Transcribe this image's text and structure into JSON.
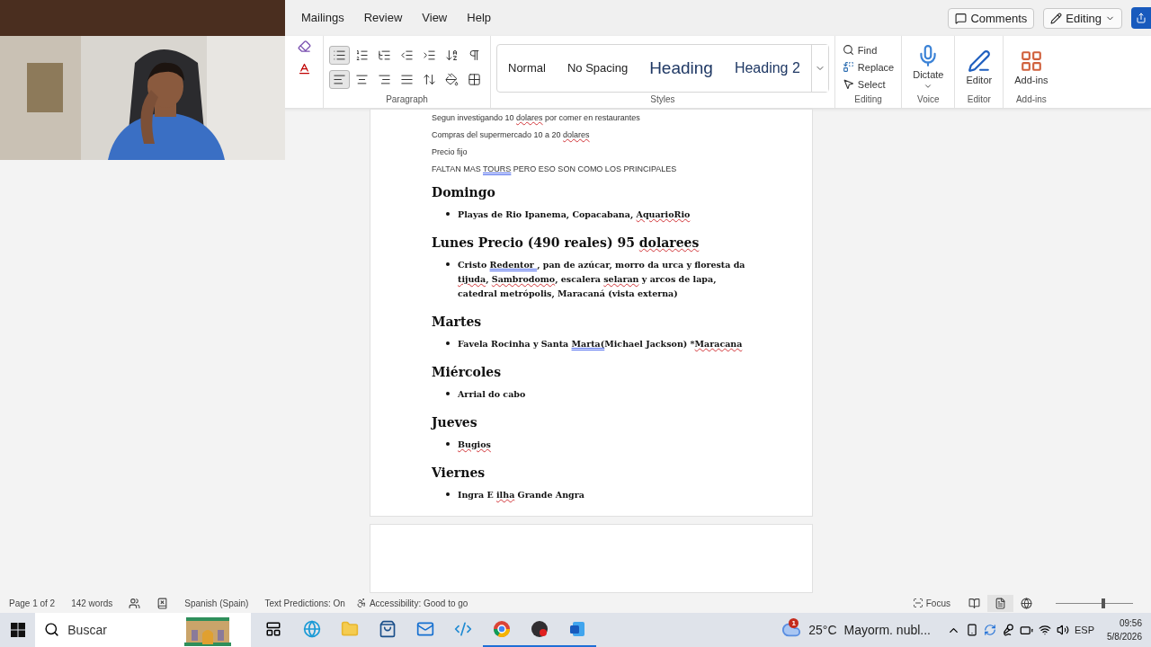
{
  "ribbon_tabs": [
    {
      "label": "Mailings",
      "selected": false
    },
    {
      "label": "Review",
      "selected": false
    },
    {
      "label": "View",
      "selected": false
    },
    {
      "label": "Help",
      "selected": false
    }
  ],
  "title_buttons": {
    "comments": "Comments",
    "editing": "Editing"
  },
  "paragraph_group": {
    "label": "Paragraph",
    "tools": [
      {
        "kind": "bullets",
        "selected": true
      },
      {
        "kind": "numbering",
        "selected": false
      },
      {
        "kind": "multilevel",
        "selected": false
      },
      {
        "kind": "outdent",
        "selected": false
      },
      {
        "kind": "indent",
        "selected": false
      },
      {
        "kind": "sort",
        "selected": false
      },
      {
        "kind": "pilcrow",
        "selected": false
      },
      {
        "kind": "align-left",
        "selected": true
      },
      {
        "kind": "align-center",
        "selected": false
      },
      {
        "kind": "align-right",
        "selected": false
      },
      {
        "kind": "justify",
        "selected": false
      },
      {
        "kind": "line-spacing",
        "selected": false
      },
      {
        "kind": "shading",
        "selected": false
      },
      {
        "kind": "borders",
        "selected": false
      }
    ]
  },
  "styles": {
    "label": "Styles",
    "items": [
      {
        "label": "Normal",
        "kind": "normal"
      },
      {
        "label": "No Spacing",
        "kind": "normal"
      },
      {
        "label": "Heading",
        "kind": "heading1"
      },
      {
        "label": "Heading 2",
        "kind": "heading2"
      }
    ]
  },
  "editing_group": {
    "label": "Editing",
    "items": [
      {
        "kind": "find",
        "label": "Find"
      },
      {
        "kind": "replace",
        "label": "Replace"
      },
      {
        "kind": "select",
        "label": "Select"
      }
    ]
  },
  "voice_group": {
    "label": "Voice",
    "button": "Dictate"
  },
  "editor_group": {
    "label": "Editor",
    "button": "Editor"
  },
  "addins_group": {
    "label": "Add-ins",
    "button": "Add-ins"
  },
  "document": {
    "blocks": [
      {
        "kind": "plain",
        "runs": [
          {
            "text": "Segun investigando 10 "
          },
          {
            "text": "dolares",
            "spelling_error": true
          },
          {
            "text": " por comer en restaurantes"
          }
        ]
      },
      {
        "kind": "plain",
        "runs": [
          {
            "text": "Compras del supermercado 10 a 20 "
          },
          {
            "text": "dolares",
            "spelling_error": true
          }
        ]
      },
      {
        "kind": "plain",
        "runs": [
          {
            "text": "Precio fijo"
          }
        ]
      },
      {
        "kind": "plain",
        "runs": [
          {
            "text": "FALTAN MAS "
          },
          {
            "text": "TOURS",
            "grammar_error": true
          },
          {
            "text": " PERO ESO SON COMO LOS PRINCIPALES"
          }
        ]
      },
      {
        "kind": "heading",
        "runs": [
          {
            "text": "Domingo"
          }
        ]
      },
      {
        "kind": "bullet",
        "runs": [
          {
            "text": "Playas de Rio Ipanema, Copacabana, "
          },
          {
            "text": "AquarioRio",
            "spelling_error": true
          }
        ]
      },
      {
        "kind": "heading",
        "runs": [
          {
            "text": "Lunes Precio (490 reales) 95 "
          },
          {
            "text": "dolarees",
            "spelling_error": true
          }
        ]
      },
      {
        "kind": "bullet",
        "runs": [
          {
            "text": " Cristo "
          },
          {
            "text": "Redentor ",
            "grammar_error": true
          },
          {
            "text": ", pan de azúcar, morro da urca y floresta da "
          },
          {
            "text": "tijuda",
            "spelling_error": true
          },
          {
            "text": ", "
          },
          {
            "text": "Sambrodomo",
            "spelling_error": true
          },
          {
            "text": ", escalera "
          },
          {
            "text": "selaran",
            "spelling_error": true
          },
          {
            "text": " y arcos de lapa, catedral metrópolis, Maracaná (vista externa)"
          }
        ]
      },
      {
        "kind": "heading",
        "runs": [
          {
            "text": "Martes"
          }
        ]
      },
      {
        "kind": "bullet",
        "runs": [
          {
            "text": "Favela Rocinha y Santa "
          },
          {
            "text": "Marta(",
            "grammar_error": true
          },
          {
            "text": "Michael Jackson) *"
          },
          {
            "text": "Maracana",
            "spelling_error": true
          }
        ]
      },
      {
        "kind": "heading",
        "runs": [
          {
            "text": "Miércoles"
          }
        ]
      },
      {
        "kind": "bullet",
        "runs": [
          {
            "text": "Arrial do cabo"
          }
        ]
      },
      {
        "kind": "heading",
        "runs": [
          {
            "text": "Jueves"
          }
        ]
      },
      {
        "kind": "bullet",
        "runs": [
          {
            "text": "Bugios",
            "spelling_error": true
          }
        ]
      },
      {
        "kind": "heading",
        "runs": [
          {
            "text": "Viernes"
          }
        ]
      },
      {
        "kind": "bullet",
        "runs": [
          {
            "text": "Ingra E "
          },
          {
            "text": "ilha",
            "spelling_error": true
          },
          {
            "text": " Grande Angra"
          }
        ]
      }
    ]
  },
  "status_bar": {
    "page": "Page 1 of 2",
    "words": "142 words",
    "language": "Spanish (Spain)",
    "predictions": "Text Predictions: On",
    "accessibility": "Accessibility: Good to go",
    "focus": "Focus",
    "views": [
      {
        "kind": "read",
        "selected": false
      },
      {
        "kind": "print",
        "selected": true
      },
      {
        "kind": "web",
        "selected": false
      }
    ],
    "zoom": {
      "level": 0.62
    }
  },
  "taskbar": {
    "search_placeholder": "Buscar",
    "weather": {
      "badge": "1",
      "temperature": "25°C",
      "condition": "Mayorm. nubl..."
    },
    "language": "ESP",
    "time": "09:56",
    "date": "5/8/2026"
  }
}
